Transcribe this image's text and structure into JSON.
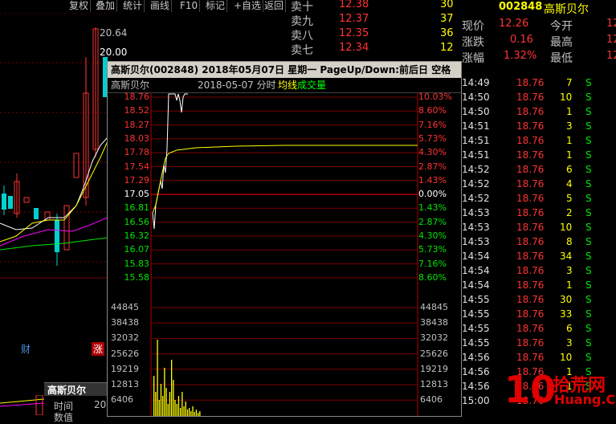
{
  "toolbar": {
    "items": [
      "复权",
      "叠加",
      "统计",
      "画线",
      "F10",
      "标记",
      "+自选",
      "返回"
    ]
  },
  "kline": {
    "high_label": "20.64",
    "price_tag": "20.00",
    "cai_label": "财",
    "zhang_label": "涨",
    "name_tab": "高斯贝尔",
    "time_label": "时间",
    "ask_label": "数值",
    "time_value": "20"
  },
  "orderbook": {
    "levels": [
      {
        "label": "卖十",
        "price": "12.38",
        "vol": "30"
      },
      {
        "label": "卖九",
        "price": "12.37",
        "vol": "37"
      },
      {
        "label": "卖八",
        "price": "12.35",
        "vol": "36"
      },
      {
        "label": "卖七",
        "price": "12.34",
        "vol": "12"
      }
    ]
  },
  "popup": {
    "title": "高斯贝尔(002848)  2018年05月07日 星期一  PageUp/Down:前后日 空格键:操作  通达信(R)",
    "header_name": "高斯贝尔",
    "header_date": "2018-05-07 分时",
    "header_avg": "均线",
    "header_vol": "成交量",
    "price_axis": [
      {
        "price": "18.76",
        "pct": "10.03%",
        "cls": "red"
      },
      {
        "price": "18.52",
        "pct": "8.60%",
        "cls": "red"
      },
      {
        "price": "18.27",
        "pct": "7.16%",
        "cls": "red"
      },
      {
        "price": "18.03",
        "pct": "5.73%",
        "cls": "red"
      },
      {
        "price": "17.78",
        "pct": "4.30%",
        "cls": "red"
      },
      {
        "price": "17.54",
        "pct": "2.87%",
        "cls": "red"
      },
      {
        "price": "17.29",
        "pct": "1.43%",
        "cls": "red"
      },
      {
        "price": "17.05",
        "pct": "0.00%",
        "cls": "white"
      },
      {
        "price": "16.81",
        "pct": "1.43%",
        "cls": "green"
      },
      {
        "price": "16.56",
        "pct": "2.87%",
        "cls": "green"
      },
      {
        "price": "16.32",
        "pct": "4.30%",
        "cls": "green"
      },
      {
        "price": "16.07",
        "pct": "5.73%",
        "cls": "green"
      },
      {
        "price": "15.83",
        "pct": "7.16%",
        "cls": "green"
      },
      {
        "price": "15.58",
        "pct": "8.60%",
        "cls": "green"
      }
    ],
    "volume_axis": [
      "44845",
      "38438",
      "32032",
      "25626",
      "19219",
      "12813",
      "6406"
    ]
  },
  "quote": {
    "code": "002848",
    "name": "高斯贝尔",
    "rows": [
      {
        "l1": "现价",
        "v1": "12.26",
        "l2": "今开",
        "v2": "12"
      },
      {
        "l1": "涨跌",
        "v1": "0.16",
        "l2": "最高",
        "v2": "12"
      },
      {
        "l1": "涨幅",
        "v1": "1.32%",
        "l2": "最低",
        "v2": "12"
      }
    ]
  },
  "trades": [
    {
      "time": "14:49",
      "price": "18.76",
      "vol": "7",
      "flag": "S"
    },
    {
      "time": "14:50",
      "price": "18.76",
      "vol": "10",
      "flag": "S"
    },
    {
      "time": "14:50",
      "price": "18.76",
      "vol": "1",
      "flag": "S"
    },
    {
      "time": "14:51",
      "price": "18.76",
      "vol": "3",
      "flag": "S"
    },
    {
      "time": "14:51",
      "price": "18.76",
      "vol": "1",
      "flag": "S"
    },
    {
      "time": "14:51",
      "price": "18.76",
      "vol": "1",
      "flag": "S"
    },
    {
      "time": "14:52",
      "price": "18.76",
      "vol": "6",
      "flag": "S"
    },
    {
      "time": "14:52",
      "price": "18.76",
      "vol": "4",
      "flag": "S"
    },
    {
      "time": "14:52",
      "price": "18.76",
      "vol": "5",
      "flag": "S"
    },
    {
      "time": "14:53",
      "price": "18.76",
      "vol": "2",
      "flag": "S"
    },
    {
      "time": "14:53",
      "price": "18.76",
      "vol": "10",
      "flag": "S"
    },
    {
      "time": "14:53",
      "price": "18.76",
      "vol": "8",
      "flag": "S"
    },
    {
      "time": "14:54",
      "price": "18.76",
      "vol": "34",
      "flag": "S"
    },
    {
      "time": "14:54",
      "price": "18.76",
      "vol": "3",
      "flag": "S"
    },
    {
      "time": "14:54",
      "price": "18.76",
      "vol": "1",
      "flag": "S"
    },
    {
      "time": "14:55",
      "price": "18.76",
      "vol": "30",
      "flag": "S"
    },
    {
      "time": "14:55",
      "price": "18.76",
      "vol": "33",
      "flag": "S"
    },
    {
      "time": "14:55",
      "price": "18.76",
      "vol": "6",
      "flag": "S"
    },
    {
      "time": "14:55",
      "price": "18.76",
      "vol": "3",
      "flag": "S"
    },
    {
      "time": "14:56",
      "price": "18.76",
      "vol": "10",
      "flag": "S"
    },
    {
      "time": "14:56",
      "price": "18.76",
      "vol": "1",
      "flag": "S"
    },
    {
      "time": "14:56",
      "price": "18.76",
      "vol": "1",
      "flag": "S"
    },
    {
      "time": "15:00",
      "price": "18.76",
      "vol": "",
      "flag": ""
    }
  ],
  "watermark": {
    "text1": "10",
    "text2": "拾荒网",
    "text3": "Huang.CN"
  },
  "colors": {
    "red": "#ff3333",
    "green": "#00e600",
    "yellow": "#ffff00",
    "grid": "#8b0000"
  }
}
